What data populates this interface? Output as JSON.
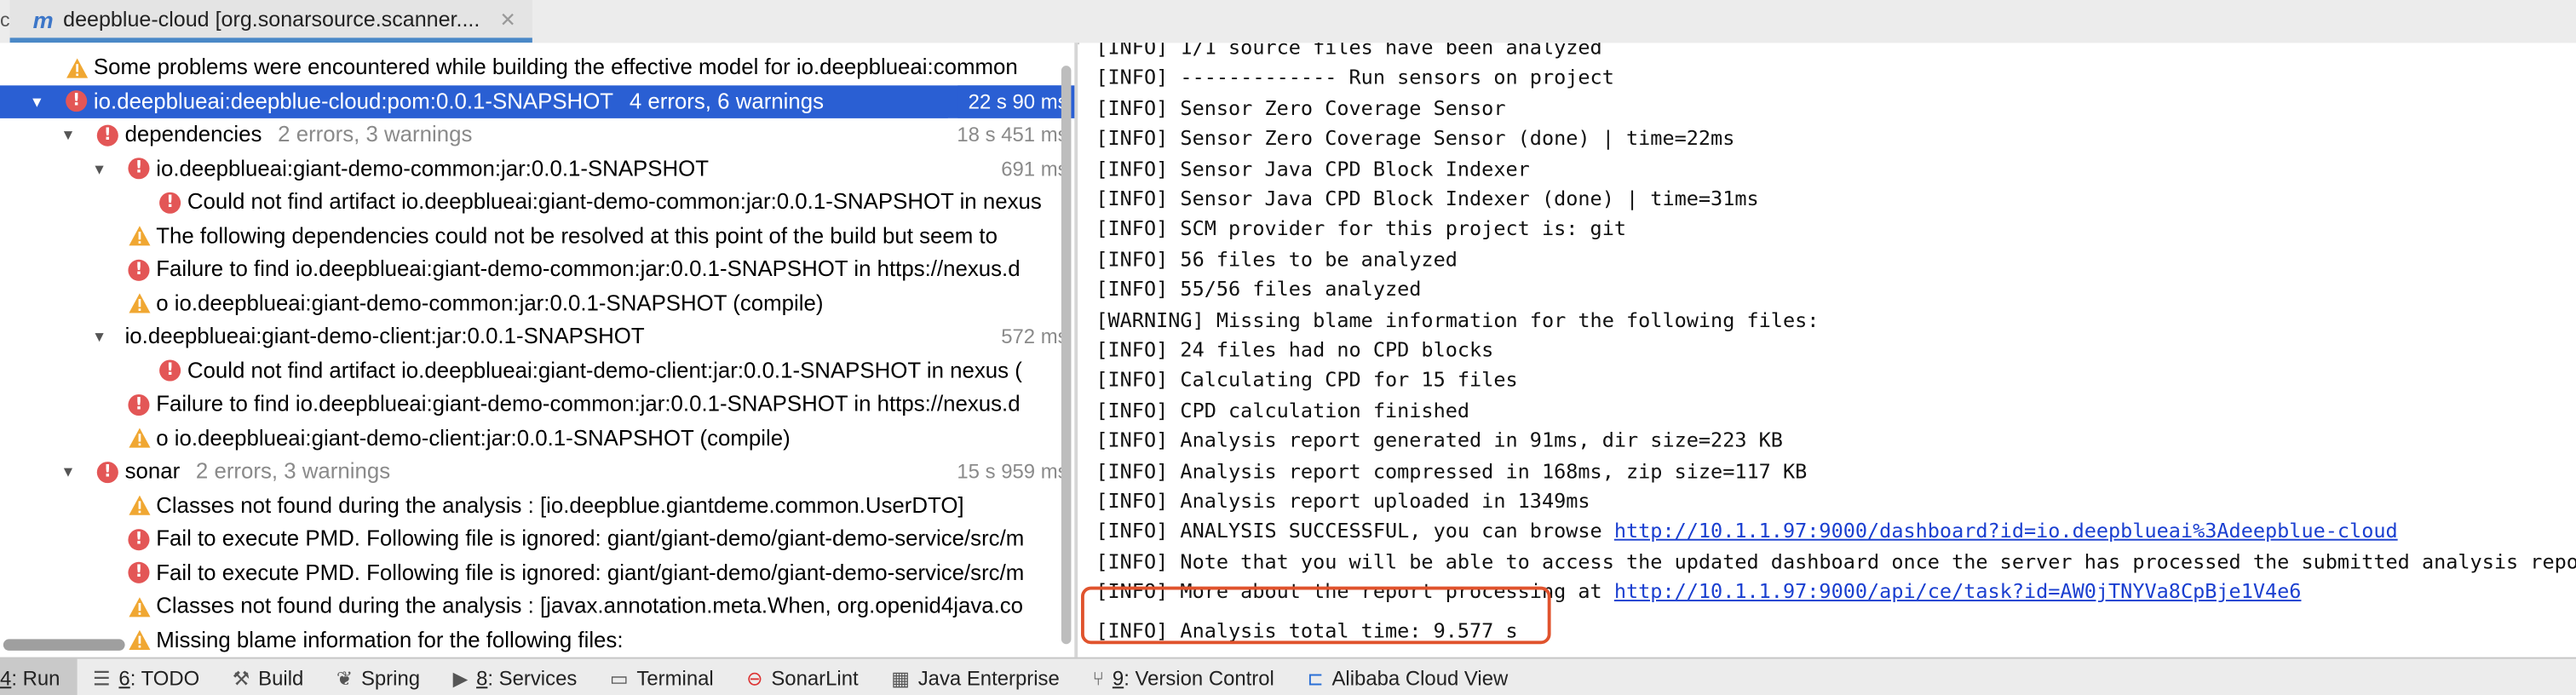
{
  "tab": {
    "left_mark": "c",
    "icon": "m",
    "title": "deepblue-cloud [org.sonarsource.scanner....",
    "close": "✕"
  },
  "tree": [
    {
      "indent": 0,
      "tri": "",
      "icon": "warning",
      "text": "Some problems were encountered while building the effective model for io.deepblueai:common",
      "count": "",
      "time": "",
      "selected": false
    },
    {
      "indent": 0,
      "tri": "▼",
      "icon": "error",
      "text": "io.deepblueai:deepblue-cloud:pom:0.0.1-SNAPSHOT",
      "count": "4 errors, 6 warnings",
      "time": "22 s 90 ms",
      "selected": true
    },
    {
      "indent": 1,
      "tri": "▼",
      "icon": "error",
      "text": "dependencies",
      "count": "2 errors, 3 warnings",
      "time": "18 s 451 ms",
      "selected": false
    },
    {
      "indent": 2,
      "tri": "▼",
      "icon": "error",
      "text": "io.deepblueai:giant-demo-common:jar:0.0.1-SNAPSHOT",
      "count": "",
      "time": "691 ms",
      "selected": false
    },
    {
      "indent": 3,
      "tri": "",
      "icon": "error",
      "text": "Could not find artifact io.deepblueai:giant-demo-common:jar:0.0.1-SNAPSHOT in nexus",
      "count": "",
      "time": "",
      "selected": false
    },
    {
      "indent": 2,
      "tri": "",
      "icon": "warning",
      "text": "The following dependencies could not be resolved at this point of the build but seem to",
      "count": "",
      "time": "",
      "selected": false
    },
    {
      "indent": 2,
      "tri": "",
      "icon": "error",
      "text": "Failure to find io.deepblueai:giant-demo-common:jar:0.0.1-SNAPSHOT in https://nexus.d",
      "count": "",
      "time": "",
      "selected": false
    },
    {
      "indent": 2,
      "tri": "",
      "icon": "warning",
      "text": "o io.deepblueai:giant-demo-common:jar:0.0.1-SNAPSHOT (compile)",
      "count": "",
      "time": "",
      "selected": false
    },
    {
      "indent": 2,
      "tri": "▼",
      "icon": "",
      "text": "io.deepblueai:giant-demo-client:jar:0.0.1-SNAPSHOT",
      "count": "",
      "time": "572 ms",
      "selected": false
    },
    {
      "indent": 3,
      "tri": "",
      "icon": "error",
      "text": "Could not find artifact io.deepblueai:giant-demo-client:jar:0.0.1-SNAPSHOT in nexus (",
      "count": "",
      "time": "",
      "selected": false
    },
    {
      "indent": 2,
      "tri": "",
      "icon": "error",
      "text": "Failure to find io.deepblueai:giant-demo-common:jar:0.0.1-SNAPSHOT in https://nexus.d",
      "count": "",
      "time": "",
      "selected": false
    },
    {
      "indent": 2,
      "tri": "",
      "icon": "warning",
      "text": "o io.deepblueai:giant-demo-client:jar:0.0.1-SNAPSHOT (compile)",
      "count": "",
      "time": "",
      "selected": false
    },
    {
      "indent": 1,
      "tri": "▼",
      "icon": "error",
      "text": "sonar",
      "count": "2 errors, 3 warnings",
      "time": "15 s 959 ms",
      "selected": false
    },
    {
      "indent": 2,
      "tri": "",
      "icon": "warning",
      "text": "Classes not found during the analysis : [io.deepblue.giantdeme.common.UserDTO]",
      "count": "",
      "time": "",
      "selected": false
    },
    {
      "indent": 2,
      "tri": "",
      "icon": "error",
      "text": "Fail to execute PMD. Following file is ignored: giant/giant-demo/giant-demo-service/src/m",
      "count": "",
      "time": "",
      "selected": false
    },
    {
      "indent": 2,
      "tri": "",
      "icon": "error",
      "text": "Fail to execute PMD. Following file is ignored: giant/giant-demo/giant-demo-service/src/m",
      "count": "",
      "time": "",
      "selected": false
    },
    {
      "indent": 2,
      "tri": "",
      "icon": "warning",
      "text": "Classes not found during the analysis : [javax.annotation.meta.When, org.openid4java.co",
      "count": "",
      "time": "",
      "selected": false
    },
    {
      "indent": 2,
      "tri": "",
      "icon": "warning",
      "text": "Missing blame information for the following files:",
      "count": "",
      "time": "",
      "selected": false
    }
  ],
  "console": [
    {
      "text": "[INFO] 1/1 source files have been analyzed",
      "link": ""
    },
    {
      "text": "[INFO] ------------- Run sensors on project",
      "link": ""
    },
    {
      "text": "[INFO] Sensor Zero Coverage Sensor",
      "link": ""
    },
    {
      "text": "[INFO] Sensor Zero Coverage Sensor (done) | time=22ms",
      "link": ""
    },
    {
      "text": "[INFO] Sensor Java CPD Block Indexer",
      "link": ""
    },
    {
      "text": "[INFO] Sensor Java CPD Block Indexer (done) | time=31ms",
      "link": ""
    },
    {
      "text": "[INFO] SCM provider for this project is: git",
      "link": ""
    },
    {
      "text": "[INFO] 56 files to be analyzed",
      "link": ""
    },
    {
      "text": "[INFO] 55/56 files analyzed",
      "link": ""
    },
    {
      "text": "[WARNING] Missing blame information for the following files:",
      "link": ""
    },
    {
      "text": "[INFO] 24 files had no CPD blocks",
      "link": ""
    },
    {
      "text": "[INFO] Calculating CPD for 15 files",
      "link": ""
    },
    {
      "text": "[INFO] CPD calculation finished",
      "link": ""
    },
    {
      "text": "[INFO] Analysis report generated in 91ms, dir size=223 KB",
      "link": ""
    },
    {
      "text": "[INFO] Analysis report compressed in 168ms, zip size=117 KB",
      "link": ""
    },
    {
      "text": "[INFO] Analysis report uploaded in 1349ms",
      "link": ""
    },
    {
      "text": "[INFO] ANALYSIS SUCCESSFUL, you can browse ",
      "link": "http://10.1.1.97:9000/dashboard?id=io.deepblueai%3Adeepblue-cloud"
    },
    {
      "text": "[INFO] Note that you will be able to access the updated dashboard once the server has processed the submitted analysis report",
      "link": ""
    },
    {
      "text": "[INFO] More about the report processing at ",
      "link": "http://10.1.1.97:9000/api/ce/task?id=AW0jTNYVa8CpBje1V4e6"
    },
    {
      "text": "[INFO] Analysis total time: 9.577 s",
      "link": ""
    }
  ],
  "toolbar": [
    {
      "key": "run",
      "icon": "",
      "num": "4",
      "label": ": Run",
      "active": true
    },
    {
      "key": "todo",
      "icon": "list-icon",
      "num": "6",
      "label": ": TODO",
      "active": false
    },
    {
      "key": "build",
      "icon": "hammer-icon",
      "num": "",
      "label": "Build",
      "active": false
    },
    {
      "key": "spring",
      "icon": "leaf-icon",
      "num": "",
      "label": "Spring",
      "active": false
    },
    {
      "key": "services",
      "icon": "play-circle-icon",
      "num": "8",
      "label": ": Services",
      "active": false
    },
    {
      "key": "terminal",
      "icon": "terminal-icon",
      "num": "",
      "label": "Terminal",
      "active": false
    },
    {
      "key": "sonarlint",
      "icon": "sonarlint-icon",
      "num": "",
      "label": "SonarLint",
      "active": false
    },
    {
      "key": "java-enterprise",
      "icon": "java-enterprise-icon",
      "num": "",
      "label": "Java Enterprise",
      "active": false
    },
    {
      "key": "version-control",
      "icon": "vcs-icon",
      "num": "9",
      "label": ": Version Control",
      "active": false
    },
    {
      "key": "alibaba",
      "icon": "alibaba-cloud-icon",
      "num": "",
      "label": "Alibaba Cloud View",
      "active": false
    }
  ],
  "colors": {
    "selection": "#2a5fd3",
    "error": "#e35656",
    "warning": "#f0a732",
    "link": "#1a3fd0",
    "highlight_border": "#e0532d"
  }
}
